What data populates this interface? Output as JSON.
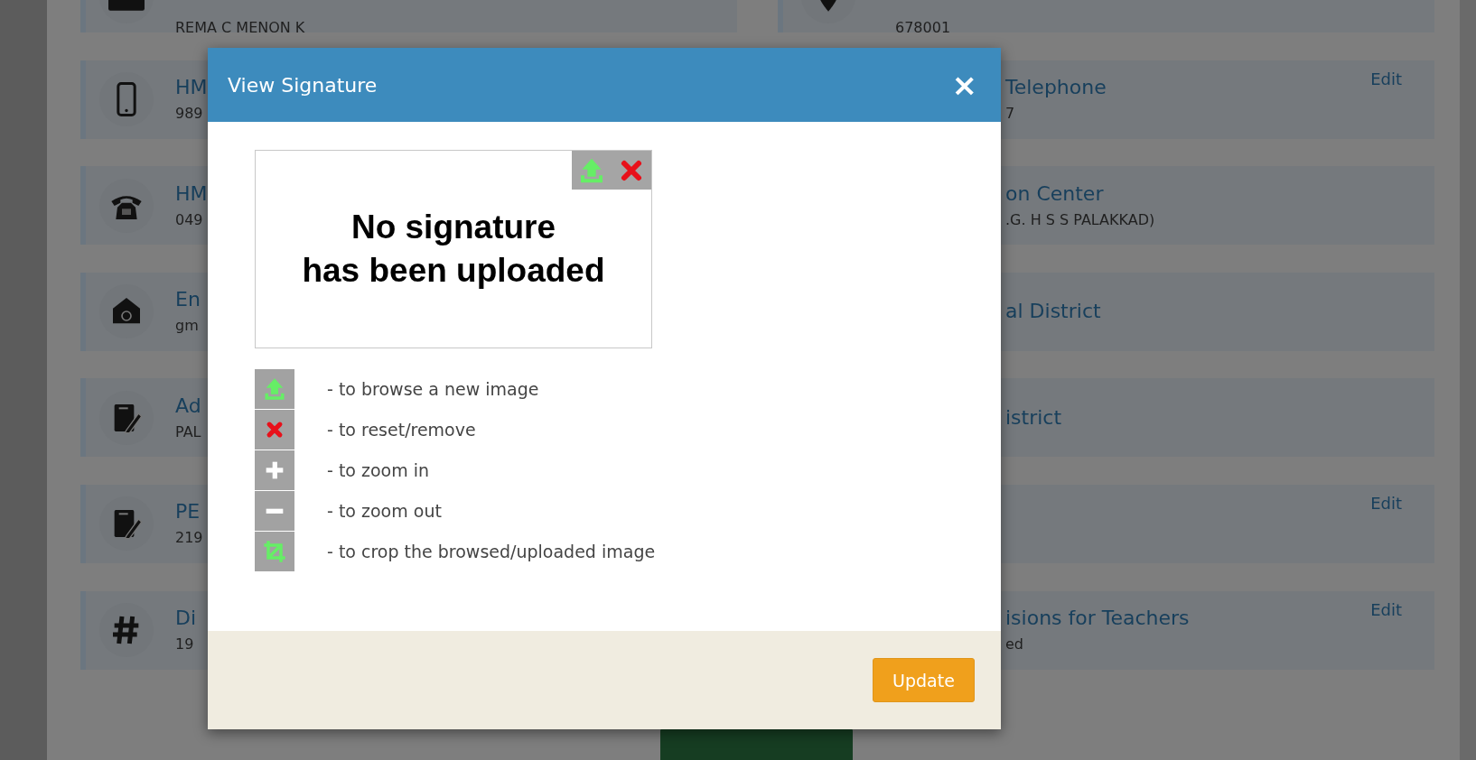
{
  "background": {
    "left_cards": [
      {
        "value": "REMA C MENON K"
      },
      {
        "title": "HM",
        "value": "989"
      },
      {
        "title": "HM",
        "value": "049"
      },
      {
        "title": "En",
        "value": "gm"
      },
      {
        "title": "Ad",
        "value": "PAL"
      },
      {
        "title": "PE",
        "value": "219"
      },
      {
        "title": "Di",
        "value": "19"
      }
    ],
    "right_cards": [
      {
        "value": "678001"
      },
      {
        "title": "Telephone",
        "value": "7",
        "edit": "Edit"
      },
      {
        "title": "on Center",
        "value": ".G. H S S PALAKKAD)"
      },
      {
        "title": "al District"
      },
      {
        "title": "istrict"
      },
      {
        "edit": "Edit"
      },
      {
        "title": "isions for Teachers",
        "value": "ed",
        "edit": "Edit"
      }
    ]
  },
  "modal": {
    "title": "View Signature",
    "close": "×",
    "signature_box": {
      "message_lines": [
        "No signature",
        "has been uploaded"
      ],
      "tools": [
        {
          "kind": "upload"
        },
        {
          "kind": "remove"
        }
      ]
    },
    "legend": [
      {
        "kind": "upload",
        "text": "- to browse a new image"
      },
      {
        "kind": "remove",
        "text": "- to reset/remove"
      },
      {
        "kind": "plus",
        "text": "- to zoom in"
      },
      {
        "kind": "minus",
        "text": "- to zoom out"
      },
      {
        "kind": "crop",
        "text": "- to crop the browsed/uploaded image"
      }
    ],
    "footer_button": "Update"
  }
}
